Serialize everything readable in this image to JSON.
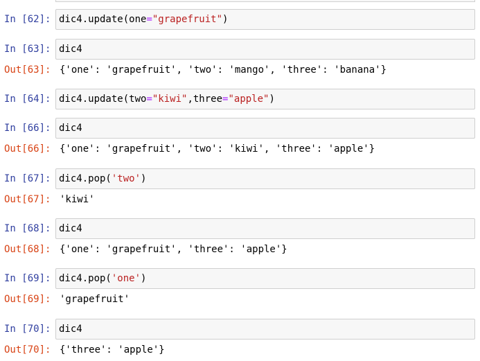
{
  "cells": [
    {
      "in_prompt": "In [62]:",
      "code": [
        {
          "t": "dic4.update(one",
          "c": ""
        },
        {
          "t": "=",
          "c": "op"
        },
        {
          "t": "\"grapefruit\"",
          "c": "str"
        },
        {
          "t": ")",
          "c": ""
        }
      ],
      "out_prompt": "",
      "output": ""
    },
    {
      "in_prompt": "In [63]:",
      "code": [
        {
          "t": "dic4",
          "c": ""
        }
      ],
      "out_prompt": "Out[63]:",
      "output": "{'one': 'grapefruit', 'two': 'mango', 'three': 'banana'}"
    },
    {
      "in_prompt": "In [64]:",
      "code": [
        {
          "t": "dic4.update(two",
          "c": ""
        },
        {
          "t": "=",
          "c": "op"
        },
        {
          "t": "\"kiwi\"",
          "c": "str"
        },
        {
          "t": ",three",
          "c": ""
        },
        {
          "t": "=",
          "c": "op"
        },
        {
          "t": "\"apple\"",
          "c": "str"
        },
        {
          "t": ")",
          "c": ""
        }
      ],
      "out_prompt": "",
      "output": ""
    },
    {
      "in_prompt": "In [66]:",
      "code": [
        {
          "t": "dic4",
          "c": ""
        }
      ],
      "out_prompt": "Out[66]:",
      "output": "{'one': 'grapefruit', 'two': 'kiwi', 'three': 'apple'}"
    },
    {
      "in_prompt": "In [67]:",
      "code": [
        {
          "t": "dic4.pop(",
          "c": ""
        },
        {
          "t": "'two'",
          "c": "str"
        },
        {
          "t": ")",
          "c": ""
        }
      ],
      "out_prompt": "Out[67]:",
      "output": "'kiwi'"
    },
    {
      "in_prompt": "In [68]:",
      "code": [
        {
          "t": "dic4",
          "c": ""
        }
      ],
      "out_prompt": "Out[68]:",
      "output": "{'one': 'grapefruit', 'three': 'apple'}"
    },
    {
      "in_prompt": "In [69]:",
      "code": [
        {
          "t": "dic4.pop(",
          "c": ""
        },
        {
          "t": "'one'",
          "c": "str"
        },
        {
          "t": ")",
          "c": ""
        }
      ],
      "out_prompt": "Out[69]:",
      "output": "'grapefruit'"
    },
    {
      "in_prompt": "In [70]:",
      "code": [
        {
          "t": "dic4",
          "c": ""
        }
      ],
      "out_prompt": "Out[70]:",
      "output": "{'three': 'apple'}"
    }
  ]
}
